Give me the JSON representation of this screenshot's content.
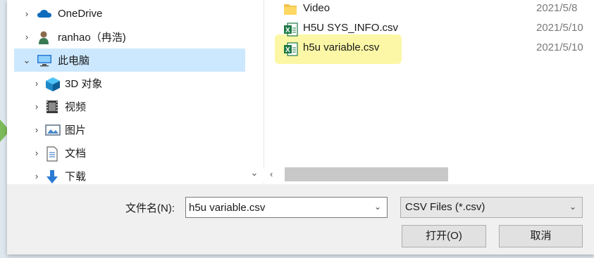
{
  "nav": {
    "items": [
      {
        "label": "OneDrive",
        "icon": "cloud-icon",
        "expanded": false
      },
      {
        "label": "ranhao（冉浩)",
        "icon": "user-icon",
        "expanded": false
      },
      {
        "label": "此电脑",
        "icon": "computer-icon",
        "expanded": true,
        "selected": true
      },
      {
        "label": "3D 对象",
        "icon": "cube-icon",
        "expanded": false
      },
      {
        "label": "视频",
        "icon": "video-icon",
        "expanded": false
      },
      {
        "label": "图片",
        "icon": "picture-icon",
        "expanded": false
      },
      {
        "label": "文档",
        "icon": "document-icon",
        "expanded": false
      },
      {
        "label": "下载",
        "icon": "download-icon",
        "expanded": false
      }
    ]
  },
  "files": [
    {
      "name": "Video",
      "date": "2021/5/8",
      "icon": "folder-icon"
    },
    {
      "name": "H5U SYS_INFO.csv",
      "date": "2021/5/10",
      "icon": "excel-csv-icon"
    },
    {
      "name": "h5u variable.csv",
      "date": "2021/5/10",
      "icon": "excel-csv-icon",
      "highlighted": true
    }
  ],
  "filename": {
    "label": "文件名(N):",
    "value": "h5u variable.csv"
  },
  "filetype": {
    "selected": "CSV Files (*.csv)"
  },
  "buttons": {
    "open": "打开(O)",
    "cancel": "取消"
  },
  "colors": {
    "selection": "#cce8ff",
    "highlight": "#fbf7a6",
    "excel_green": "#1d7a45",
    "onedrive_blue": "#0f6cbd"
  }
}
